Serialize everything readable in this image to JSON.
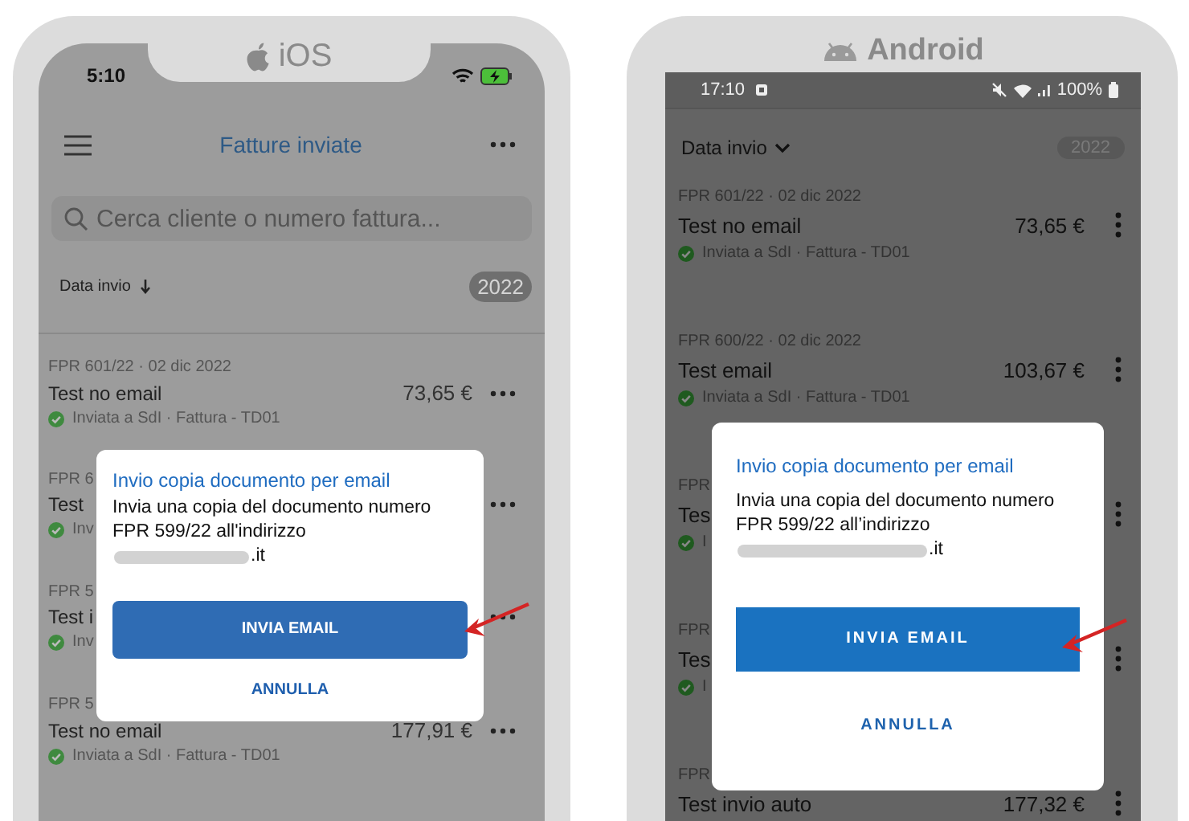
{
  "ios": {
    "label": "iOS",
    "time": "5:10",
    "header_title": "Fatture inviate",
    "search": {
      "placeholder": "Cerca cliente o numero fattura..."
    },
    "sort_label": "Data invio",
    "year": "2022",
    "rows": [
      {
        "meta": "FPR 601/22 · 02 dic 2022",
        "title": "Test no email",
        "amount": "73,65 €",
        "status": "Inviata a SdI · Fattura - TD01"
      },
      {
        "meta": "FPR 6",
        "title": "Test",
        "status": "Inv"
      },
      {
        "meta": "FPR 5",
        "title": "Test i",
        "status": "Inv"
      },
      {
        "meta": "FPR 5",
        "title": "Test no email",
        "amount": "177,91 €",
        "status": "Inviata a SdI · Fattura - TD01"
      }
    ],
    "dialog": {
      "title": "Invio copia documento per email",
      "body": "Invia una copia del documento numero FPR 599/22 all'indirizzo",
      "email_end": ".it",
      "primary": "INVIA EMAIL",
      "secondary": "ANNULLA"
    }
  },
  "android": {
    "label": "Android",
    "time": "17:10",
    "battery": "100%",
    "sort_label": "Data invio",
    "year": "2022",
    "rows": [
      {
        "meta": "FPR 601/22 · 02 dic 2022",
        "title": "Test no email",
        "amount": "73,65 €",
        "status": "Inviata a SdI · Fattura - TD01"
      },
      {
        "meta": "FPR 600/22 · 02 dic 2022",
        "title": "Test email",
        "amount": "103,67 €",
        "status": "Inviata a SdI · Fattura - TD01"
      },
      {
        "meta": "FPR",
        "title": "Tes",
        "status": "I"
      },
      {
        "meta": "FPR",
        "title": "Tes",
        "status": "I"
      },
      {
        "meta": "FPR",
        "title": "Test invio auto",
        "amount": "177,32 €"
      }
    ],
    "dialog": {
      "title": "Invio copia documento per email",
      "body": "Invia una copia del documento numero FPR 599/22 all’indirizzo",
      "email_end": ".it",
      "primary": "INVIA EMAIL",
      "secondary": "ANNULLA"
    }
  }
}
